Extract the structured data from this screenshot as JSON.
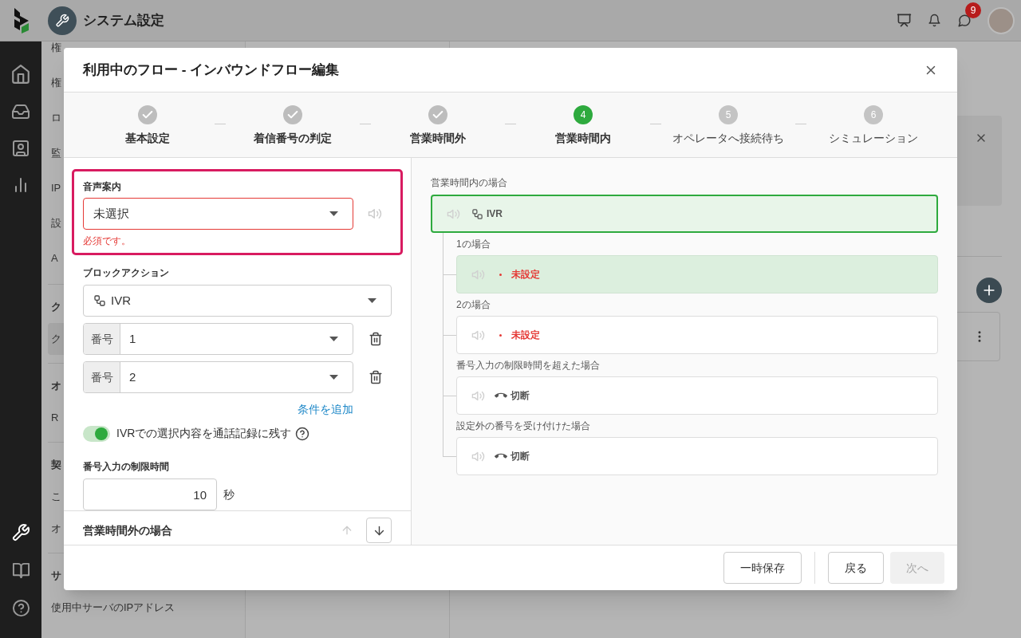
{
  "header": {
    "title": "システム設定",
    "chat_badge": "9"
  },
  "nav": {
    "groups": [
      {
        "items": [
          {
            "label": "権",
            "selected": false
          },
          {
            "label": "権",
            "selected": false
          },
          {
            "label": "ロ",
            "selected": false
          },
          {
            "label": "監",
            "selected": false
          },
          {
            "label": "IP",
            "selected": false
          },
          {
            "label": "設",
            "selected": false
          },
          {
            "label": "A",
            "selected": false
          }
        ]
      },
      {
        "title": "ク",
        "items": [
          {
            "label": "ク",
            "selected": true
          }
        ]
      },
      {
        "title": "オ",
        "items": [
          {
            "label": "R",
            "selected": false
          }
        ]
      },
      {
        "title": "契",
        "items": [
          {
            "label": "こ",
            "selected": false
          },
          {
            "label": "オ",
            "selected": false
          }
        ]
      },
      {
        "title": "サ",
        "items": [
          {
            "label": "使用中サーバのIPアドレス",
            "selected": false
          }
        ]
      }
    ]
  },
  "modal": {
    "title": "利用中のフロー - インバウンドフロー編集",
    "steps": [
      {
        "label": "基本設定",
        "kind": "done"
      },
      {
        "label": "着信番号の判定",
        "kind": "done"
      },
      {
        "label": "営業時間外",
        "kind": "done"
      },
      {
        "number": "4",
        "label": "営業時間内",
        "kind": "current"
      },
      {
        "number": "5",
        "label": "オペレータへ接続待ち",
        "kind": "pending"
      },
      {
        "number": "6",
        "label": "シミュレーション",
        "kind": "pending"
      }
    ],
    "form": {
      "voice_guide": {
        "label": "音声案内",
        "value": "未選択",
        "error": "必須です。",
        "highlighted": true
      },
      "block_action": {
        "label": "ブロックアクション",
        "value": "IVR"
      },
      "conditions": [
        {
          "addon": "番号",
          "value": "1"
        },
        {
          "addon": "番号",
          "value": "2"
        }
      ],
      "add_condition": "条件を追加",
      "record_toggle": {
        "label": "IVRでの選択内容を通話記録に残す",
        "on": true
      },
      "timeout": {
        "label": "番号入力の制限時間",
        "value": "10",
        "unit": "秒"
      }
    },
    "next_section": {
      "title": "営業時間外の場合",
      "up_disabled": true,
      "down_disabled": false
    },
    "flow": {
      "title": "営業時間内の場合",
      "root": {
        "label": "IVR",
        "selected": true
      },
      "branches": [
        {
          "label": "1の場合",
          "highlighted": true,
          "action": {
            "kind": "unset",
            "text": "未設定"
          }
        },
        {
          "label": "2の場合",
          "highlighted": false,
          "action": {
            "kind": "unset",
            "text": "未設定"
          }
        },
        {
          "label": "番号入力の制限時間を超えた場合",
          "highlighted": false,
          "action": {
            "kind": "hangup",
            "text": "切断"
          }
        },
        {
          "label": "設定外の番号を受け付けた場合",
          "highlighted": false,
          "action": {
            "kind": "hangup",
            "text": "切断"
          }
        }
      ]
    },
    "footer": {
      "buttons": [
        {
          "label": "一時保存",
          "disabled": false
        },
        {
          "label": "戻る",
          "disabled": false
        },
        {
          "label": "次へ",
          "disabled": true
        }
      ]
    }
  }
}
